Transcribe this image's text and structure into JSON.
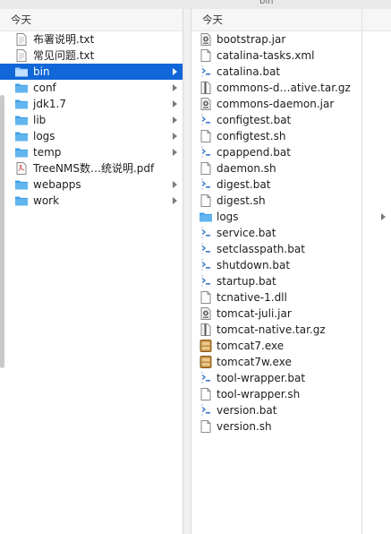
{
  "window": {
    "title": "bin"
  },
  "left_column": {
    "header": "今天",
    "items": [
      {
        "label": "布署说明.txt",
        "icon": "text-doc-icon",
        "folder": false,
        "selected": false
      },
      {
        "label": "常见问题.txt",
        "icon": "text-doc-icon",
        "folder": false,
        "selected": false
      },
      {
        "label": "bin",
        "icon": "folder-icon",
        "folder": true,
        "selected": true
      },
      {
        "label": "conf",
        "icon": "folder-icon",
        "folder": true,
        "selected": false
      },
      {
        "label": "jdk1.7",
        "icon": "folder-icon",
        "folder": true,
        "selected": false
      },
      {
        "label": "lib",
        "icon": "folder-icon",
        "folder": true,
        "selected": false
      },
      {
        "label": "logs",
        "icon": "folder-icon",
        "folder": true,
        "selected": false
      },
      {
        "label": "temp",
        "icon": "folder-icon",
        "folder": true,
        "selected": false
      },
      {
        "label": "TreeNMS数…统说明.pdf",
        "icon": "pdf-doc-icon",
        "folder": false,
        "selected": false
      },
      {
        "label": "webapps",
        "icon": "folder-icon",
        "folder": true,
        "selected": false
      },
      {
        "label": "work",
        "icon": "folder-icon",
        "folder": true,
        "selected": false
      }
    ]
  },
  "right_column": {
    "header": "今天",
    "items": [
      {
        "label": "bootstrap.jar",
        "icon": "jar-file-icon",
        "folder": false
      },
      {
        "label": "catalina-tasks.xml",
        "icon": "blank-doc-icon",
        "folder": false
      },
      {
        "label": "catalina.bat",
        "icon": "script-file-icon",
        "folder": false
      },
      {
        "label": "commons-d…ative.tar.gz",
        "icon": "archive-file-icon",
        "folder": false
      },
      {
        "label": "commons-daemon.jar",
        "icon": "jar-file-icon",
        "folder": false
      },
      {
        "label": "configtest.bat",
        "icon": "script-file-icon",
        "folder": false
      },
      {
        "label": "configtest.sh",
        "icon": "blank-doc-icon",
        "folder": false
      },
      {
        "label": "cpappend.bat",
        "icon": "script-file-icon",
        "folder": false
      },
      {
        "label": "daemon.sh",
        "icon": "blank-doc-icon",
        "folder": false
      },
      {
        "label": "digest.bat",
        "icon": "script-file-icon",
        "folder": false
      },
      {
        "label": "digest.sh",
        "icon": "blank-doc-icon",
        "folder": false
      },
      {
        "label": "logs",
        "icon": "folder-icon",
        "folder": true
      },
      {
        "label": "service.bat",
        "icon": "script-file-icon",
        "folder": false
      },
      {
        "label": "setclasspath.bat",
        "icon": "script-file-icon",
        "folder": false
      },
      {
        "label": "shutdown.bat",
        "icon": "script-file-icon",
        "folder": false
      },
      {
        "label": "startup.bat",
        "icon": "script-file-icon",
        "folder": false
      },
      {
        "label": "tcnative-1.dll",
        "icon": "blank-doc-icon",
        "folder": false
      },
      {
        "label": "tomcat-juli.jar",
        "icon": "jar-file-icon",
        "folder": false
      },
      {
        "label": "tomcat-native.tar.gz",
        "icon": "archive-file-icon",
        "folder": false
      },
      {
        "label": "tomcat7.exe",
        "icon": "exe-file-icon",
        "folder": false
      },
      {
        "label": "tomcat7w.exe",
        "icon": "exe-file-icon",
        "folder": false
      },
      {
        "label": "tool-wrapper.bat",
        "icon": "script-file-icon",
        "folder": false
      },
      {
        "label": "tool-wrapper.sh",
        "icon": "blank-doc-icon",
        "folder": false
      },
      {
        "label": "version.bat",
        "icon": "script-file-icon",
        "folder": false
      },
      {
        "label": "version.sh",
        "icon": "blank-doc-icon",
        "folder": false
      }
    ]
  },
  "colors": {
    "selection": "#1166d8",
    "folder": "#3fa1e8",
    "exe": "#c48a3a"
  }
}
